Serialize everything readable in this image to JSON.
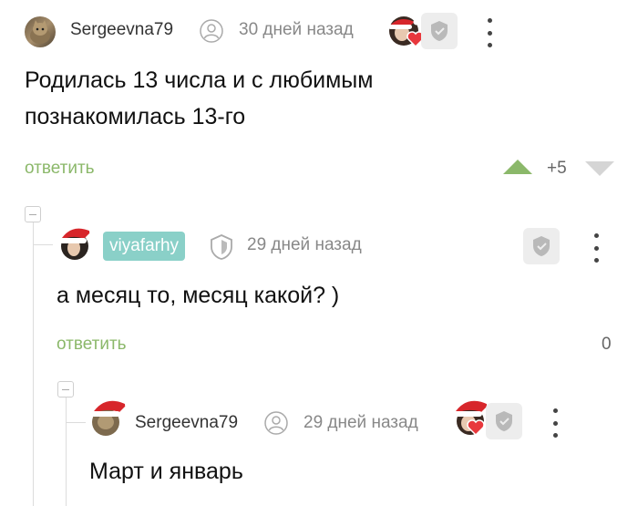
{
  "comments": [
    {
      "username": "Sergeevna79",
      "time": "30 дней назад",
      "text_lines": [
        "Родилась 13 числа и с любимым",
        "познакомилась 13-го"
      ],
      "reply_label": "ответить",
      "rating": "+5"
    },
    {
      "username": "viyafarhy",
      "time": "29 дней назад",
      "text_lines": [
        "а месяц то, месяц какой? )"
      ],
      "reply_label": "ответить",
      "rating": "0"
    },
    {
      "username": "Sergeevna79",
      "time": "29 дней назад",
      "text_lines": [
        "Март и январь"
      ]
    }
  ],
  "colors": {
    "accent_green": "#8bb86a",
    "badge_teal": "#8ad0c8",
    "shield_bg": "#ededed"
  },
  "icons": [
    "user-icon",
    "shield-icon",
    "more-vertical-icon",
    "upvote-icon",
    "downvote-icon",
    "collapse-icon",
    "santa-hat-icon",
    "heart-icon"
  ]
}
